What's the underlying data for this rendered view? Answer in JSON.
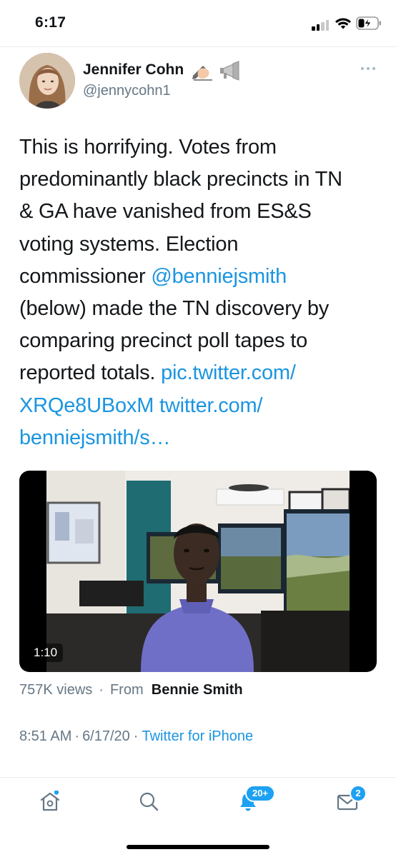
{
  "status_bar": {
    "time": "6:17"
  },
  "tweet": {
    "author": {
      "name": "Jennifer Cohn",
      "name_emojis": [
        "writing-hand-icon",
        "megaphone-icon"
      ],
      "handle": "@jennycohn1"
    },
    "text_lines": [
      [
        {
          "t": "This is horrifying. Votes from"
        }
      ],
      [
        {
          "t": "predominantly black precincts in TN"
        }
      ],
      [
        {
          "t": "& GA have vanished from ES&S"
        }
      ],
      [
        {
          "t": "voting systems. Election"
        }
      ],
      [
        {
          "t": "commissioner "
        },
        {
          "t": "@benniejsmith",
          "link": true
        }
      ],
      [
        {
          "t": "(below) made the TN discovery by"
        }
      ],
      [
        {
          "t": "comparing precinct poll tapes to"
        }
      ],
      [
        {
          "t": "reported totals. "
        },
        {
          "t": "pic.twitter.com/",
          "link": true
        }
      ],
      [
        {
          "t": "XRQe8UBoxM twitter.com/",
          "link": true
        }
      ],
      [
        {
          "t": "benniejsmith/s…",
          "link": true
        }
      ]
    ],
    "video": {
      "duration": "1:10"
    },
    "views": "757K views",
    "separator": "·",
    "from_label": "From",
    "from_name": "Bennie Smith",
    "time": "8:51 AM",
    "date": "6/17/20",
    "source": "Twitter for iPhone"
  },
  "tab_bar": {
    "tabs": [
      {
        "name": "home",
        "icon": "home-icon"
      },
      {
        "name": "search",
        "icon": "search-icon"
      },
      {
        "name": "notifications",
        "icon": "bell-icon",
        "badge": "20+"
      },
      {
        "name": "messages",
        "icon": "mail-icon",
        "badge": "2"
      }
    ]
  },
  "colors": {
    "link": "#1b95e0",
    "accent": "#1da1f2",
    "secondary_text": "#657786",
    "primary_text": "#14171a"
  }
}
